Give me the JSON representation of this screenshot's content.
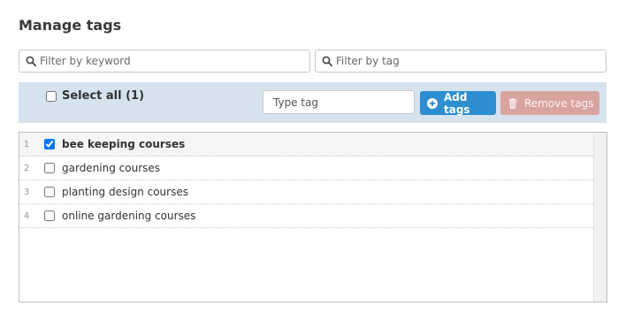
{
  "page": {
    "title": "Manage tags"
  },
  "filters": {
    "keyword_placeholder": "Filter by keyword",
    "tag_placeholder": "Filter by tag"
  },
  "toolbar": {
    "select_all_label": "Select all (1)",
    "type_tag_placeholder": "Type tag",
    "add_tags_label": "Add tags",
    "remove_tags_label": "Remove tags"
  },
  "tags": [
    {
      "index": "1",
      "label": "bee keeping courses",
      "checked": true
    },
    {
      "index": "2",
      "label": "gardening courses",
      "checked": false
    },
    {
      "index": "3",
      "label": "planting design courses",
      "checked": false
    },
    {
      "index": "4",
      "label": "online gardening courses",
      "checked": false
    }
  ],
  "colors": {
    "toolbar_bg": "#d6e2ee",
    "add_button": "#2d8fd0",
    "remove_button": "#d9a4a0"
  }
}
